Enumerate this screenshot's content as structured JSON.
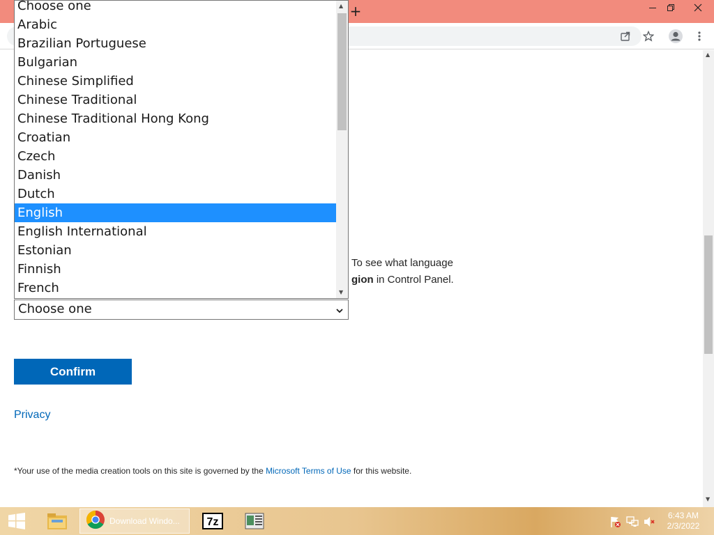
{
  "browser": {
    "new_tab_label": "+"
  },
  "page": {
    "info_line1": "To see what language",
    "info_line2_bold": "gion",
    "info_line2_rest": " in Control Panel.",
    "select_value": "Choose one",
    "confirm_label": "Confirm",
    "privacy_label": "Privacy",
    "footer_prefix": "*Your use of the media creation tools on this site is governed by the ",
    "footer_link": "Microsoft Terms of Use",
    "footer_suffix": " for this website."
  },
  "dropdown": {
    "options": [
      "Choose one",
      "Arabic",
      "Brazilian Portuguese",
      "Bulgarian",
      "Chinese Simplified",
      "Chinese Traditional",
      "Chinese Traditional Hong Kong",
      "Croatian",
      "Czech",
      "Danish",
      "Dutch",
      "English",
      "English International",
      "Estonian",
      "Finnish",
      "French"
    ],
    "highlighted": "English"
  },
  "taskbar": {
    "chrome_task_label": "Download Windo...",
    "sevenzip_label": "7z",
    "clock_time": "6:43 AM",
    "clock_date": "2/3/2022"
  },
  "colors": {
    "titlebar": "#f28b7d",
    "accent": "#0067b8",
    "highlight": "#1e90ff"
  },
  "icons": [
    "close-icon",
    "restore-icon",
    "minimize-icon",
    "share-icon",
    "star-icon",
    "profile-icon",
    "menu-dots-icon",
    "chevron-down-icon",
    "windows-start-icon",
    "file-explorer-icon",
    "chrome-icon",
    "seven-zip-icon",
    "app-icon",
    "flag-icon",
    "network-icon",
    "volume-icon"
  ]
}
